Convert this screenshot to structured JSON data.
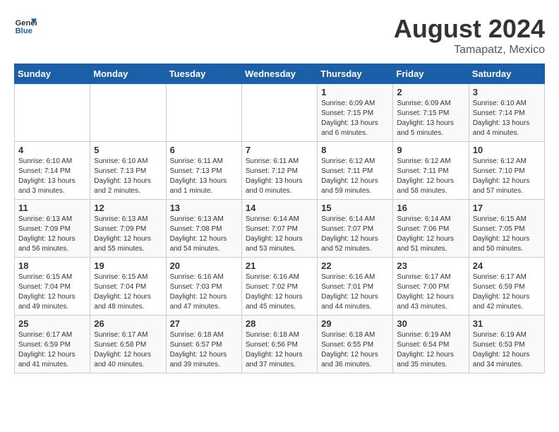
{
  "header": {
    "logo_line1": "General",
    "logo_line2": "Blue",
    "month_year": "August 2024",
    "location": "Tamapatz, Mexico"
  },
  "weekdays": [
    "Sunday",
    "Monday",
    "Tuesday",
    "Wednesday",
    "Thursday",
    "Friday",
    "Saturday"
  ],
  "weeks": [
    [
      {
        "day": "",
        "info": ""
      },
      {
        "day": "",
        "info": ""
      },
      {
        "day": "",
        "info": ""
      },
      {
        "day": "",
        "info": ""
      },
      {
        "day": "1",
        "info": "Sunrise: 6:09 AM\nSunset: 7:15 PM\nDaylight: 13 hours\nand 6 minutes."
      },
      {
        "day": "2",
        "info": "Sunrise: 6:09 AM\nSunset: 7:15 PM\nDaylight: 13 hours\nand 5 minutes."
      },
      {
        "day": "3",
        "info": "Sunrise: 6:10 AM\nSunset: 7:14 PM\nDaylight: 13 hours\nand 4 minutes."
      }
    ],
    [
      {
        "day": "4",
        "info": "Sunrise: 6:10 AM\nSunset: 7:14 PM\nDaylight: 13 hours\nand 3 minutes."
      },
      {
        "day": "5",
        "info": "Sunrise: 6:10 AM\nSunset: 7:13 PM\nDaylight: 13 hours\nand 2 minutes."
      },
      {
        "day": "6",
        "info": "Sunrise: 6:11 AM\nSunset: 7:13 PM\nDaylight: 13 hours\nand 1 minute."
      },
      {
        "day": "7",
        "info": "Sunrise: 6:11 AM\nSunset: 7:12 PM\nDaylight: 13 hours\nand 0 minutes."
      },
      {
        "day": "8",
        "info": "Sunrise: 6:12 AM\nSunset: 7:11 PM\nDaylight: 12 hours\nand 59 minutes."
      },
      {
        "day": "9",
        "info": "Sunrise: 6:12 AM\nSunset: 7:11 PM\nDaylight: 12 hours\nand 58 minutes."
      },
      {
        "day": "10",
        "info": "Sunrise: 6:12 AM\nSunset: 7:10 PM\nDaylight: 12 hours\nand 57 minutes."
      }
    ],
    [
      {
        "day": "11",
        "info": "Sunrise: 6:13 AM\nSunset: 7:09 PM\nDaylight: 12 hours\nand 56 minutes."
      },
      {
        "day": "12",
        "info": "Sunrise: 6:13 AM\nSunset: 7:09 PM\nDaylight: 12 hours\nand 55 minutes."
      },
      {
        "day": "13",
        "info": "Sunrise: 6:13 AM\nSunset: 7:08 PM\nDaylight: 12 hours\nand 54 minutes."
      },
      {
        "day": "14",
        "info": "Sunrise: 6:14 AM\nSunset: 7:07 PM\nDaylight: 12 hours\nand 53 minutes."
      },
      {
        "day": "15",
        "info": "Sunrise: 6:14 AM\nSunset: 7:07 PM\nDaylight: 12 hours\nand 52 minutes."
      },
      {
        "day": "16",
        "info": "Sunrise: 6:14 AM\nSunset: 7:06 PM\nDaylight: 12 hours\nand 51 minutes."
      },
      {
        "day": "17",
        "info": "Sunrise: 6:15 AM\nSunset: 7:05 PM\nDaylight: 12 hours\nand 50 minutes."
      }
    ],
    [
      {
        "day": "18",
        "info": "Sunrise: 6:15 AM\nSunset: 7:04 PM\nDaylight: 12 hours\nand 49 minutes."
      },
      {
        "day": "19",
        "info": "Sunrise: 6:15 AM\nSunset: 7:04 PM\nDaylight: 12 hours\nand 48 minutes."
      },
      {
        "day": "20",
        "info": "Sunrise: 6:16 AM\nSunset: 7:03 PM\nDaylight: 12 hours\nand 47 minutes."
      },
      {
        "day": "21",
        "info": "Sunrise: 6:16 AM\nSunset: 7:02 PM\nDaylight: 12 hours\nand 45 minutes."
      },
      {
        "day": "22",
        "info": "Sunrise: 6:16 AM\nSunset: 7:01 PM\nDaylight: 12 hours\nand 44 minutes."
      },
      {
        "day": "23",
        "info": "Sunrise: 6:17 AM\nSunset: 7:00 PM\nDaylight: 12 hours\nand 43 minutes."
      },
      {
        "day": "24",
        "info": "Sunrise: 6:17 AM\nSunset: 6:59 PM\nDaylight: 12 hours\nand 42 minutes."
      }
    ],
    [
      {
        "day": "25",
        "info": "Sunrise: 6:17 AM\nSunset: 6:59 PM\nDaylight: 12 hours\nand 41 minutes."
      },
      {
        "day": "26",
        "info": "Sunrise: 6:17 AM\nSunset: 6:58 PM\nDaylight: 12 hours\nand 40 minutes."
      },
      {
        "day": "27",
        "info": "Sunrise: 6:18 AM\nSunset: 6:57 PM\nDaylight: 12 hours\nand 39 minutes."
      },
      {
        "day": "28",
        "info": "Sunrise: 6:18 AM\nSunset: 6:56 PM\nDaylight: 12 hours\nand 37 minutes."
      },
      {
        "day": "29",
        "info": "Sunrise: 6:18 AM\nSunset: 6:55 PM\nDaylight: 12 hours\nand 36 minutes."
      },
      {
        "day": "30",
        "info": "Sunrise: 6:19 AM\nSunset: 6:54 PM\nDaylight: 12 hours\nand 35 minutes."
      },
      {
        "day": "31",
        "info": "Sunrise: 6:19 AM\nSunset: 6:53 PM\nDaylight: 12 hours\nand 34 minutes."
      }
    ]
  ]
}
